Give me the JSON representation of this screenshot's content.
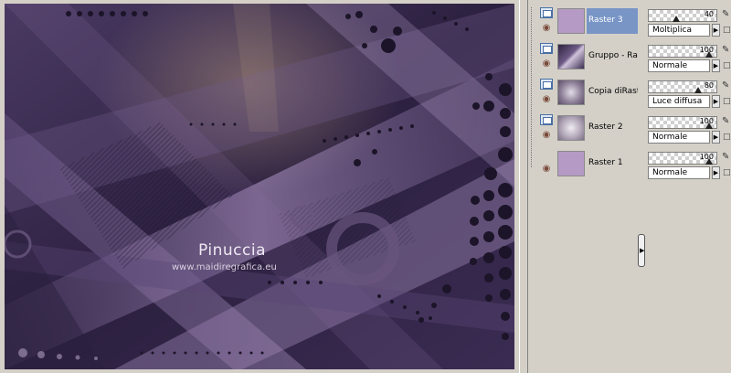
{
  "canvas": {
    "watermark_title": "Pinuccia",
    "watermark_url": "www.maidiregrafica.eu",
    "colors": {
      "dark": "#2a1f3d",
      "mid": "#5a4473",
      "light": "#a58cb9",
      "dots": "#1c1428"
    }
  },
  "layers": {
    "items": [
      {
        "name": "Raster 3",
        "selected": true,
        "thumb": "solid-lilac",
        "thumb_color": "#b49ac4"
      },
      {
        "name": "Gruppo - Ras",
        "selected": false,
        "thumb": "dark-texture",
        "thumb_color": "#4b3a5f"
      },
      {
        "name": "Copia diRaste",
        "selected": false,
        "thumb": "gradient",
        "thumb_color": "#9a8ea2"
      },
      {
        "name": "Raster 2",
        "selected": false,
        "thumb": "gradient",
        "thumb_color": "#b3a9ba"
      },
      {
        "name": "Raster 1",
        "selected": false,
        "thumb": "solid-lilac",
        "thumb_color": "#b49ac4"
      }
    ],
    "selected_color": "#7895c6"
  },
  "properties": {
    "items": [
      {
        "opacity": "40",
        "opacity_fraction": 0.4,
        "blend": "Moltiplica"
      },
      {
        "opacity": "100",
        "opacity_fraction": 1.0,
        "blend": "Normale"
      },
      {
        "opacity": "80",
        "opacity_fraction": 0.8,
        "blend": "Luce diffusa"
      },
      {
        "opacity": "100",
        "opacity_fraction": 1.0,
        "blend": "Normale"
      },
      {
        "opacity": "100",
        "opacity_fraction": 1.0,
        "blend": "Normale"
      }
    ]
  }
}
